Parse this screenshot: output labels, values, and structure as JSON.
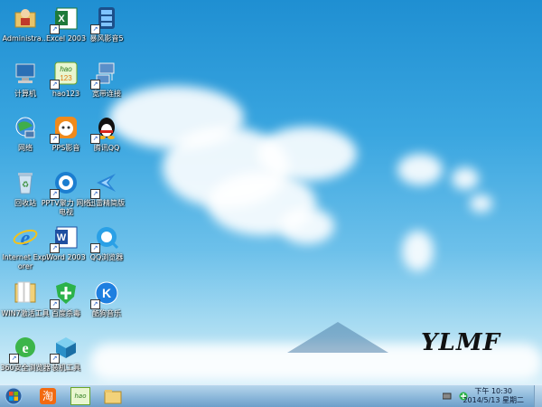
{
  "desktop_icons": [
    {
      "label": "Administra...",
      "icon": "folder-user-icon"
    },
    {
      "label": "Excel 2003",
      "icon": "excel-icon"
    },
    {
      "label": "暴风影音5",
      "icon": "media-player-icon"
    },
    {
      "label": "计算机",
      "icon": "computer-icon"
    },
    {
      "label": "hao123",
      "icon": "hao123-icon"
    },
    {
      "label": "宽带连接",
      "icon": "network-connection-icon"
    },
    {
      "label": "网络",
      "icon": "network-globe-icon"
    },
    {
      "label": "PPS影音",
      "icon": "pps-icon"
    },
    {
      "label": "腾讯QQ",
      "icon": "qq-icon"
    },
    {
      "label": "回收站",
      "icon": "recycle-bin-icon"
    },
    {
      "label": "PPTV聚力 网络电视",
      "icon": "pptv-icon"
    },
    {
      "label": "迅雷精简版",
      "icon": "thunder-icon"
    },
    {
      "label": "Internet Explorer",
      "icon": "ie-icon"
    },
    {
      "label": "Word 2003",
      "icon": "word-icon"
    },
    {
      "label": "QQ浏览器",
      "icon": "qq-browser-icon"
    },
    {
      "label": "WIN7激活工具",
      "icon": "folder-icon"
    },
    {
      "label": "百度杀毒",
      "icon": "baidu-antivirus-icon"
    },
    {
      "label": "酷狗音乐",
      "icon": "kugou-icon"
    },
    {
      "label": "360安全浏览器",
      "icon": "360-browser-icon"
    },
    {
      "label": "装机工具",
      "icon": "install-tools-icon"
    }
  ],
  "wallpaper": {
    "logo_text": "YLMF"
  },
  "taskbar": {
    "start_icon": "windows-start-icon",
    "pinned": [
      {
        "icon": "taobao-icon",
        "text": "淘"
      },
      {
        "icon": "hao123-icon",
        "text": "hao"
      },
      {
        "icon": "explorer-folder-icon",
        "text": ""
      }
    ],
    "clock": {
      "time": "下午 10:30",
      "date": "2014/5/13 星期二"
    }
  }
}
